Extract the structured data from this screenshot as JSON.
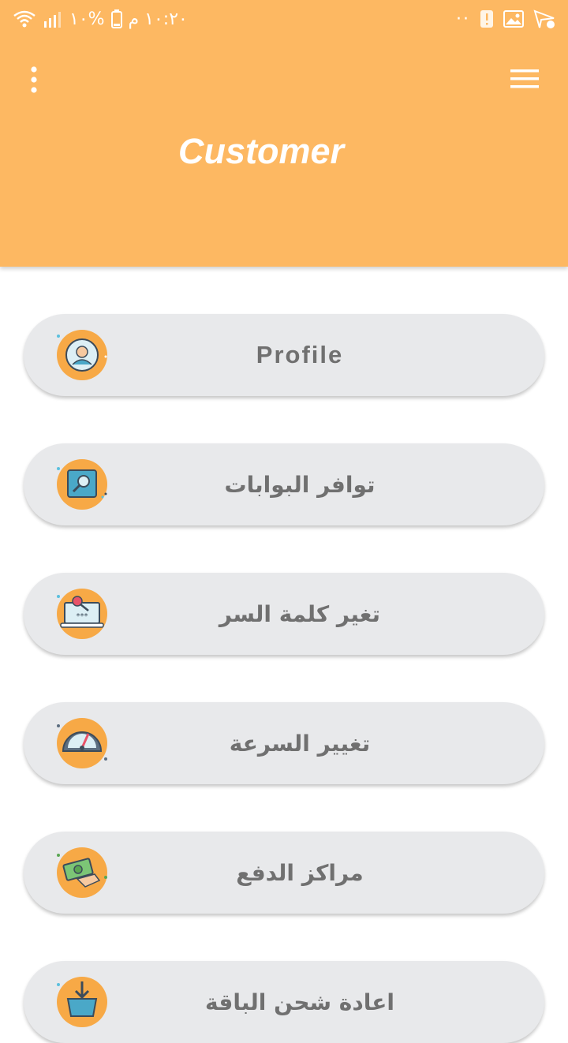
{
  "status_bar": {
    "time": "١٠:٢٠ م",
    "battery": "%١٠",
    "notification_dots": "··"
  },
  "header": {
    "title": "Customer",
    "background_color": "#FDB862"
  },
  "menu_items": [
    {
      "label": "Profile",
      "icon": "profile-icon"
    },
    {
      "label": "توافر البوابات",
      "icon": "search-screen-icon"
    },
    {
      "label": "تغير كلمة السر",
      "icon": "password-laptop-icon"
    },
    {
      "label": "تغيير السرعة",
      "icon": "speedometer-icon"
    },
    {
      "label": "مراكز الدفع",
      "icon": "payment-hand-icon"
    },
    {
      "label": "اعادة شحن الباقة",
      "icon": "basket-download-icon"
    }
  ],
  "colors": {
    "accent": "#FDB862",
    "card_background": "#E8E9EB",
    "label_text": "#707070",
    "icon_circle": "#F7A946"
  }
}
